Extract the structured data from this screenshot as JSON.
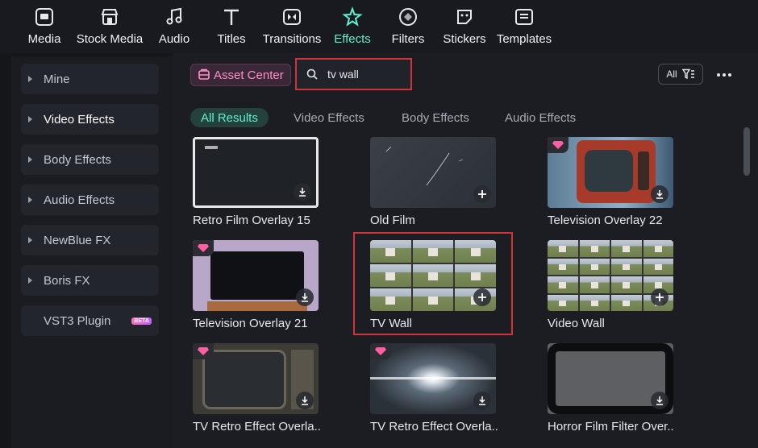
{
  "toolbar": {
    "items": [
      {
        "label": "Media",
        "icon": "media-icon"
      },
      {
        "label": "Stock Media",
        "icon": "stock-media-icon"
      },
      {
        "label": "Audio",
        "icon": "music-note-icon"
      },
      {
        "label": "Titles",
        "icon": "text-t-icon"
      },
      {
        "label": "Transitions",
        "icon": "transitions-icon"
      },
      {
        "label": "Effects",
        "icon": "sparkle-star-icon",
        "active": true
      },
      {
        "label": "Filters",
        "icon": "filters-icon"
      },
      {
        "label": "Stickers",
        "icon": "sticker-icon"
      },
      {
        "label": "Templates",
        "icon": "templates-icon"
      }
    ]
  },
  "sidebar": {
    "items": [
      {
        "label": "Mine"
      },
      {
        "label": "Video Effects",
        "active": true
      },
      {
        "label": "Body Effects"
      },
      {
        "label": "Audio Effects"
      },
      {
        "label": "NewBlue FX"
      },
      {
        "label": "Boris FX"
      },
      {
        "label": "VST3 Plugin",
        "badge": "BETA"
      }
    ]
  },
  "header": {
    "asset_center_label": "Asset Center",
    "search_value": "tv wall",
    "filter_label": "All"
  },
  "tabs": [
    {
      "label": "All Results",
      "active": true
    },
    {
      "label": "Video Effects"
    },
    {
      "label": "Body Effects"
    },
    {
      "label": "Audio Effects"
    }
  ],
  "results": [
    {
      "title": "Retro Film Overlay 15",
      "premium": false,
      "action": "download"
    },
    {
      "title": "Old Film",
      "premium": false,
      "action": "add"
    },
    {
      "title": "Television Overlay 22",
      "premium": true,
      "action": "download"
    },
    {
      "title": "Television Overlay 21",
      "premium": true,
      "action": "download"
    },
    {
      "title": "TV Wall",
      "premium": false,
      "action": "add",
      "highlighted": true
    },
    {
      "title": "Video Wall",
      "premium": false,
      "action": "add"
    },
    {
      "title": "TV Retro Effect Overla...",
      "premium": true,
      "action": "download"
    },
    {
      "title": "TV Retro Effect Overla...",
      "premium": true,
      "action": "download"
    },
    {
      "title": "Horror Film Filter Over...",
      "premium": false,
      "action": "download"
    }
  ],
  "colors": {
    "accent": "#5ff0cf",
    "highlight_border": "#d23338",
    "asset_center_text": "#ff8fc9",
    "background": "#14161a"
  }
}
